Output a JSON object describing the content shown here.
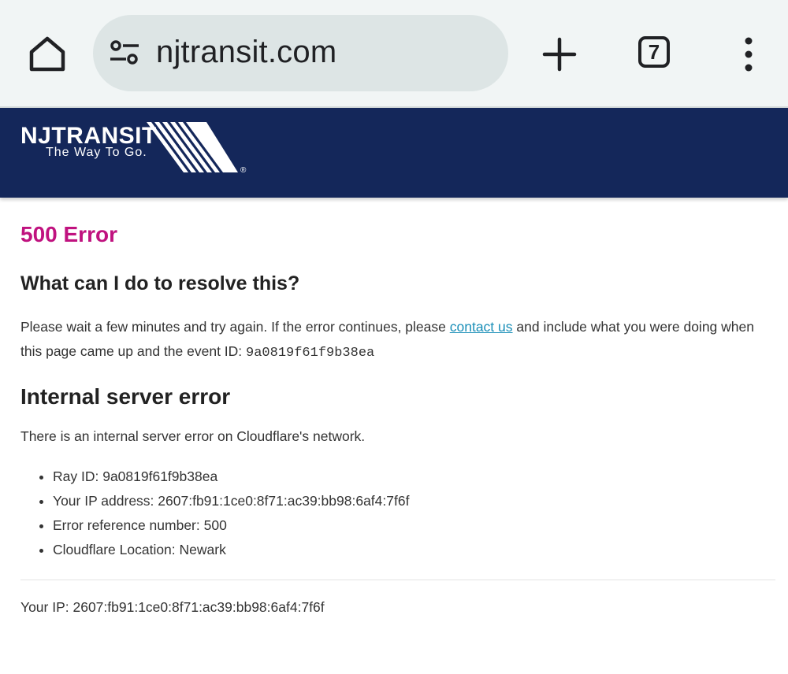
{
  "browser": {
    "url": "njtransit.com",
    "tab_count": "7"
  },
  "logo": {
    "name": "NJTRANSIT",
    "tagline": "The Way To Go.",
    "registered": "®"
  },
  "error": {
    "title": "500 Error",
    "resolve_heading": "What can I do to resolve this?",
    "resolve_text_before": "Please wait a few minutes and try again. If the error continues, please ",
    "contact_link": "contact us",
    "resolve_text_after": " and include what you were doing when this page came up and the event ID: ",
    "event_id": "9a0819f61f9b38ea",
    "ise_heading": "Internal server error",
    "ise_text": "There is an internal server error on Cloudflare's network.",
    "details": [
      "Ray ID: 9a0819f61f9b38ea",
      "Your IP address: 2607:fb91:1ce0:8f71:ac39:bb98:6af4:7f6f",
      "Error reference number: 500",
      "Cloudflare Location: Newark"
    ],
    "footer_ip": "Your IP: 2607:fb91:1ce0:8f71:ac39:bb98:6af4:7f6f"
  },
  "colors": {
    "header_bg": "#14275a",
    "error_title": "#c0127f",
    "link": "#1a8fb8"
  },
  "icons": {
    "home": "home-icon",
    "site_settings": "tune-icon",
    "new_tab": "plus-icon",
    "tabs": "tab-switcher-icon",
    "menu": "more-vert-icon"
  }
}
